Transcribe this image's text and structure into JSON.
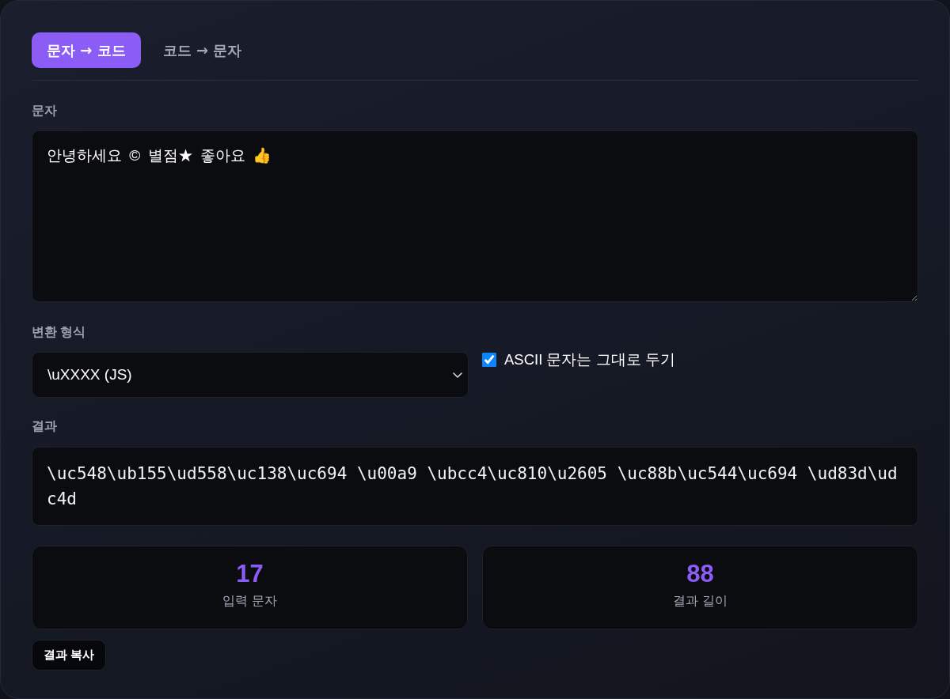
{
  "tabs": [
    {
      "label": "문자 → 코드",
      "selected": true
    },
    {
      "label": "코드 → 문자",
      "selected": false
    }
  ],
  "input": {
    "label": "문자",
    "value": "안녕하세요 © 별점★ 좋아요 👍"
  },
  "format": {
    "label": "변환 형식",
    "value": "\\uXXXX (JS)"
  },
  "ascii_option": {
    "label": "ASCII 문자는 그대로 두기",
    "checked": true
  },
  "result": {
    "label": "결과",
    "value": "\\uc548\\ub155\\ud558\\uc138\\uc694 \\u00a9 \\ubcc4\\uc810\\u2605 \\uc88b\\uc544\\uc694 \\ud83d\\udc4d"
  },
  "stats": [
    {
      "value": "17",
      "label": "입력 문자"
    },
    {
      "value": "88",
      "label": "결과 길이"
    }
  ],
  "copy_button": {
    "label": "결과 복사"
  }
}
